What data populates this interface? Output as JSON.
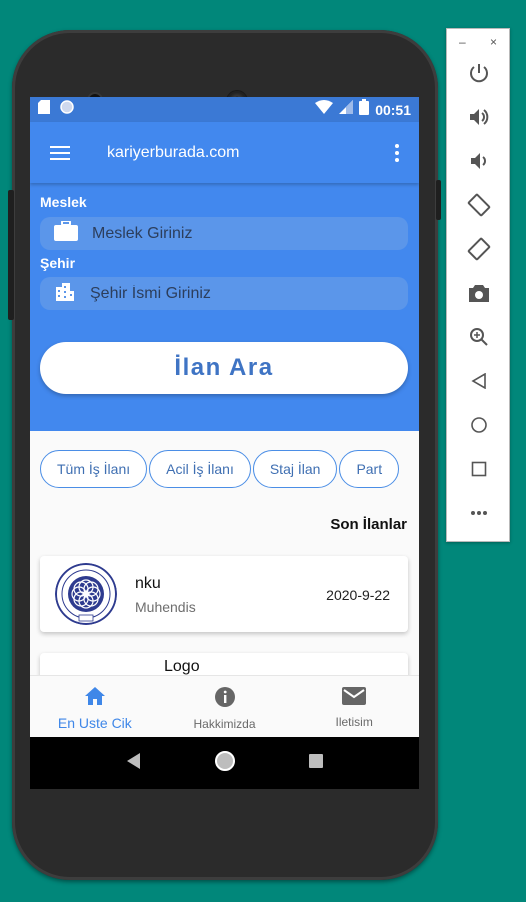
{
  "status_bar": {
    "time": "00:51"
  },
  "app_bar": {
    "title": "kariyerburada.com"
  },
  "search": {
    "job_label": "Meslek",
    "job_placeholder": "Meslek Giriniz",
    "city_label": "Şehir",
    "city_placeholder": "Şehir İsmi Giriniz",
    "button_label": "İlan Ara"
  },
  "categories": [
    "Tüm İş İlanı",
    "Acil İş İlanı",
    "Staj İlan",
    "Part"
  ],
  "section_title": "Son İlanlar",
  "listings": [
    {
      "company": "nku",
      "position": "Muhendis",
      "date": "2020-9-22",
      "logo_icon": "university-seal-icon"
    },
    {
      "company": "Logo",
      "logo_icon": "logo-brand-icon"
    }
  ],
  "bottom_nav": [
    {
      "label": "En Uste Cik",
      "icon": "home-icon",
      "active": true
    },
    {
      "label": "Hakkimizda",
      "icon": "info-icon",
      "active": false
    },
    {
      "label": "Iletisim",
      "icon": "mail-icon",
      "active": false
    }
  ],
  "emulator_toolbar": {
    "window_controls": [
      "–",
      "×"
    ],
    "buttons": [
      "power-icon",
      "volume-up-icon",
      "volume-down-icon",
      "rotate-left-icon",
      "rotate-right-icon",
      "camera-icon",
      "zoom-icon",
      "back-icon",
      "home-circle-icon",
      "overview-icon",
      "more-icon"
    ]
  },
  "colors": {
    "background": "#01877a",
    "primary": "#4288ee",
    "status_bar": "#3b79d5",
    "accent_text": "#3f74c4",
    "active_nav": "#3f87e8"
  }
}
